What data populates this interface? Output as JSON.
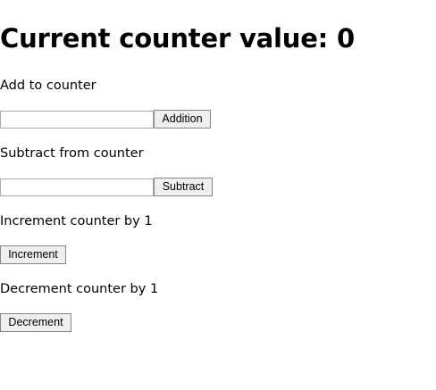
{
  "heading": {
    "prefix": "Current counter value: ",
    "value": "0"
  },
  "add": {
    "label": "Add to counter",
    "input_value": "",
    "button_label": "Addition"
  },
  "subtract": {
    "label": "Subtract from counter",
    "input_value": "",
    "button_label": "Subtract"
  },
  "increment": {
    "label": "Increment counter by 1",
    "button_label": "Increment"
  },
  "decrement": {
    "label": "Decrement counter by 1",
    "button_label": "Decrement"
  }
}
